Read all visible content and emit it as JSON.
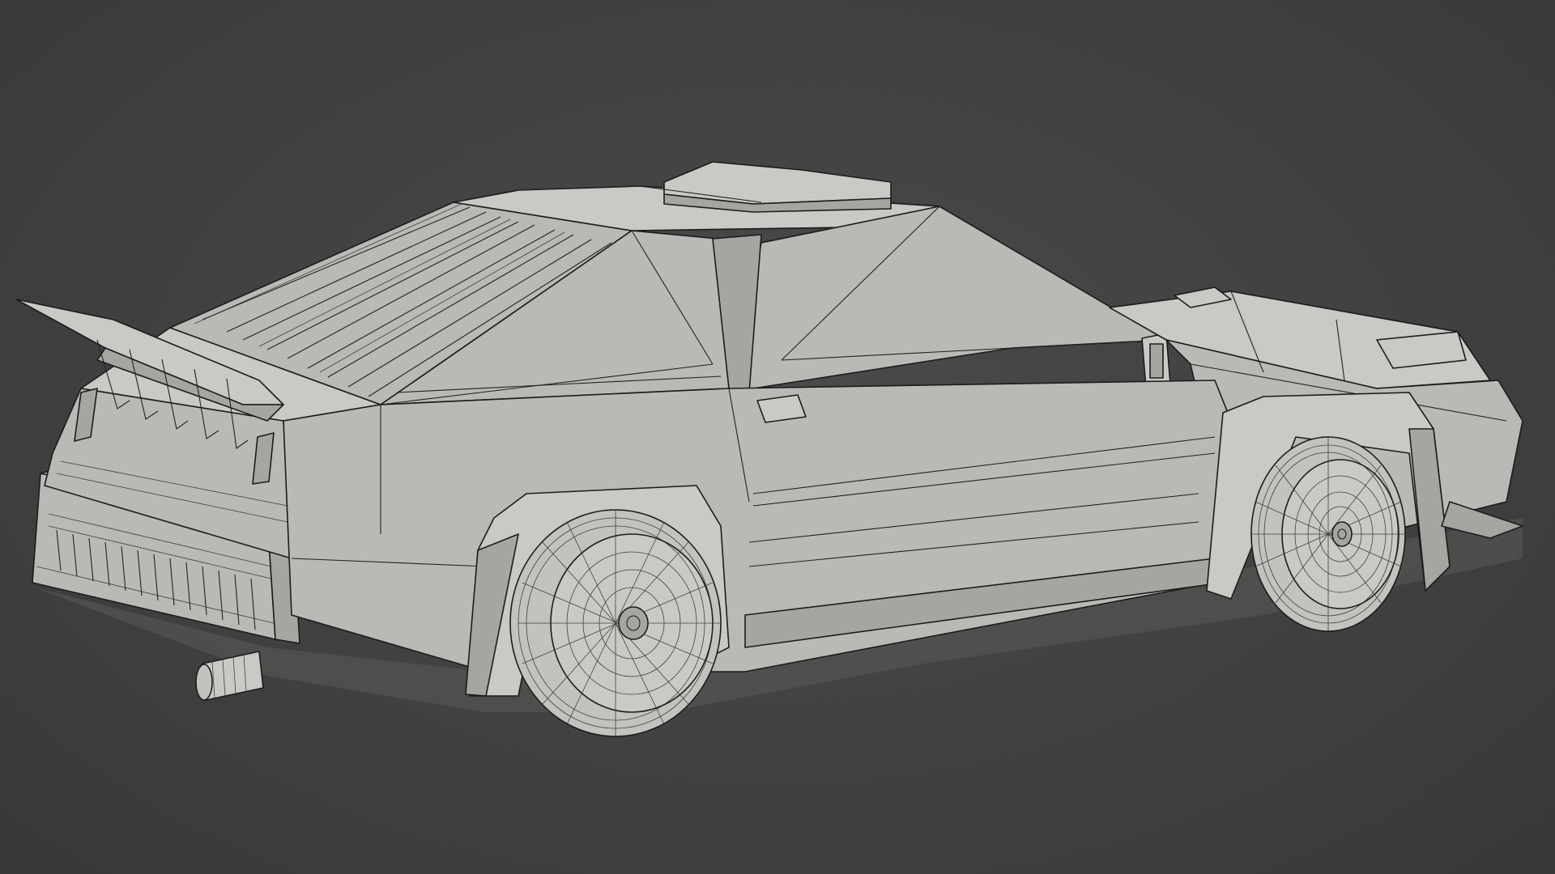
{
  "scene": {
    "object": "car",
    "view": "perspective",
    "shading": "solid",
    "overlay": "wireframe",
    "colors": {
      "background": "#414141",
      "mesh": "#b9b9b5",
      "wire": "#1c1c1c"
    }
  }
}
